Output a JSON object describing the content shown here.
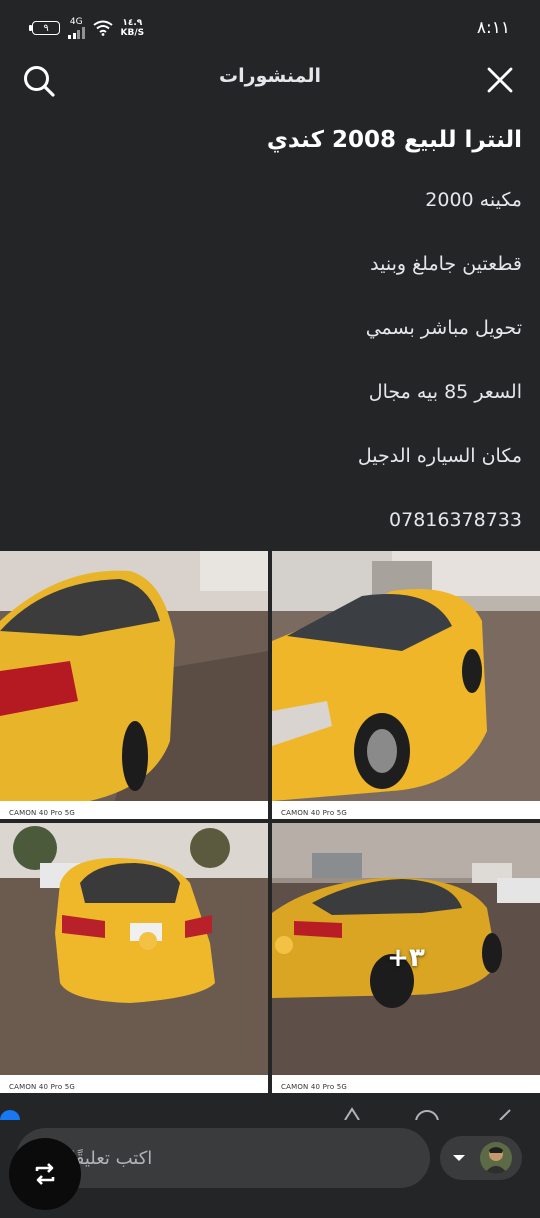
{
  "status_bar": {
    "time": "٨:١١",
    "network": "4G",
    "speed_value": "١٤.٩",
    "speed_unit": "KB/S",
    "battery": "٩"
  },
  "header": {
    "title": "المنشورات",
    "search_icon": "search-icon",
    "close_icon": "close-icon"
  },
  "post": {
    "title": "النترا للبيع 2008 كندي",
    "lines": [
      "مكينه 2000",
      "قطعتين جاملغ وبنيد",
      "تحويل مباشر بسمي",
      "السعر 85 بيه مجال",
      "مكان السياره الدجيل",
      "07816378733"
    ]
  },
  "photos": {
    "watermark": "CAMON 40 Pro 5G",
    "more_count": "+٣"
  },
  "comment": {
    "placeholder": "اكتب تعليقًا عامًا...",
    "dropdown_icon": "caret-down-icon",
    "fab_icon": "repost-icon"
  },
  "colors": {
    "background": "#242526",
    "input": "#3a3b3c",
    "car_yellow": "#f0b51c"
  }
}
